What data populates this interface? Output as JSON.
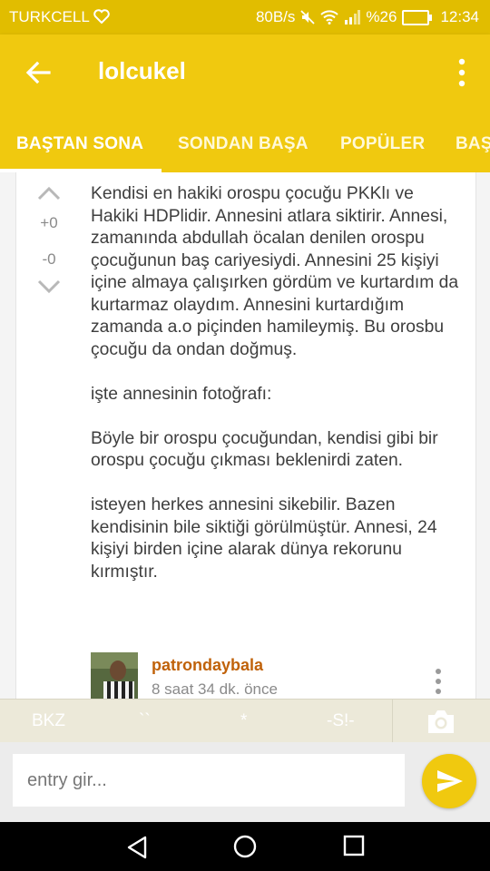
{
  "status_bar": {
    "carrier": "TURKCELL",
    "speed": "80B/s",
    "battery": "%26",
    "time": "12:34"
  },
  "app_bar": {
    "title": "lolcukel",
    "tabs": [
      "BAŞTAN SONA",
      "SONDAN BAŞA",
      "POPÜLER",
      "BAŞ"
    ]
  },
  "entry": {
    "upvotes": "+0",
    "downvotes": "-0",
    "text": "Kendisi en hakiki orospu çocuğu PKKlı ve Hakiki HDPlidir. Annesini atlara siktirir. Annesi, zamanında abdullah öcalan denilen orospu çocuğunun baş cariyesiydi. Annesini 25 kişiyi içine almaya çalışırken gördüm ve kurtardım da kurtarmaz olaydım. Annesini kurtardığım zamanda a.o piçinden hamileymiş. Bu orosbu çocuğu da ondan doğmuş.\n\nişte annesinin fotoğrafı:\n\nBöyle bir orospu çocuğundan, kendisi gibi bir orospu çocuğu çıkması beklenirdi zaten.\n\nisteyen herkes annesini sikebilir. Bazen kendisinin bile siktiği görülmüştür. Annesi, 24 kişiyi birden içine alarak dünya rekorunu kırmıştır.",
    "author": "patrondaybala",
    "timestamp": "8 saat 34 dk. önce"
  },
  "toolbar": {
    "bkz": "BKZ",
    "backtick": "``",
    "star": "*",
    "spoiler": "-S!-"
  },
  "input": {
    "placeholder": "entry gir..."
  },
  "colors": {
    "accent": "#f0c90f",
    "status_bar": "#e1bd00",
    "author": "#c0620a"
  }
}
